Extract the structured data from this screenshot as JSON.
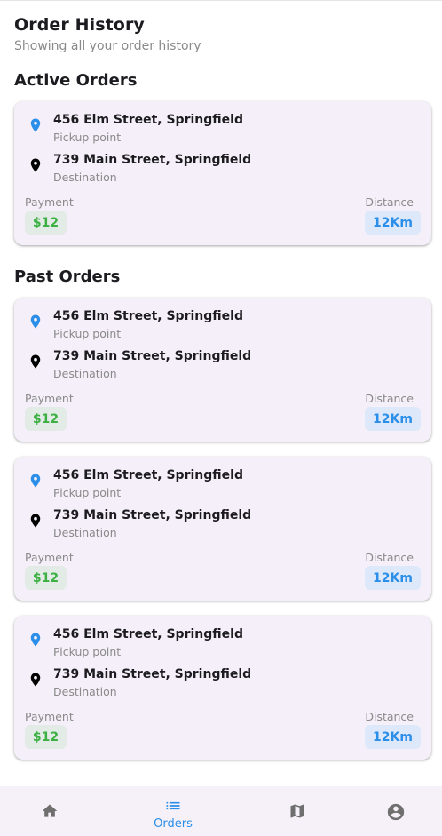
{
  "header": {
    "title": "Order History",
    "subtitle": "Showing all your order history"
  },
  "sections": {
    "active_title": "Active Orders",
    "past_title": "Past Orders"
  },
  "orders": [
    {
      "pickup": "456 Elm Street, Springfield",
      "pickup_label": "Pickup point",
      "destination": "739 Main Street, Springfield",
      "destination_label": "Destination",
      "payment_label": "Payment",
      "payment": "$12",
      "distance_label": "Distance",
      "distance": "12Km"
    },
    {
      "pickup": "456 Elm Street, Springfield",
      "pickup_label": "Pickup point",
      "destination": "739 Main Street, Springfield",
      "destination_label": "Destination",
      "payment_label": "Payment",
      "payment": "$12",
      "distance_label": "Distance",
      "distance": "12Km"
    },
    {
      "pickup": "456 Elm Street, Springfield",
      "pickup_label": "Pickup point",
      "destination": "739 Main Street, Springfield",
      "destination_label": "Destination",
      "payment_label": "Payment",
      "payment": "$12",
      "distance_label": "Distance",
      "distance": "12Km"
    },
    {
      "pickup": "456 Elm Street, Springfield",
      "pickup_label": "Pickup point",
      "destination": "739 Main Street, Springfield",
      "destination_label": "Destination",
      "payment_label": "Payment",
      "payment": "$12",
      "distance_label": "Distance",
      "distance": "12Km"
    }
  ],
  "nav": {
    "items": [
      {
        "icon": "home-icon",
        "label": ""
      },
      {
        "icon": "list-icon",
        "label": "Orders",
        "active": true
      },
      {
        "icon": "map-icon",
        "label": ""
      },
      {
        "icon": "account-icon",
        "label": ""
      }
    ]
  },
  "colors": {
    "accent": "#2b8ee8",
    "payment_green": "#3db043",
    "card_bg": "#f4eff8",
    "nav_bg": "#f6f0f8",
    "pickup_pin": "#2b8ee8",
    "destination_pin": "#000000"
  }
}
